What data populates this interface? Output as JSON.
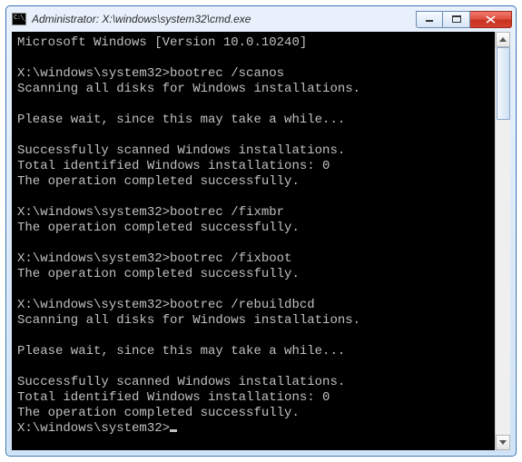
{
  "window": {
    "title": "Administrator: X:\\windows\\system32\\cmd.exe"
  },
  "terminal": {
    "banner": "Microsoft Windows [Version 10.0.10240]",
    "blocks": [
      {
        "prompt": "X:\\windows\\system32>",
        "command": "bootrec /scanos",
        "output": [
          "Scanning all disks for Windows installations.",
          "",
          "Please wait, since this may take a while...",
          "",
          "Successfully scanned Windows installations.",
          "Total identified Windows installations: 0",
          "The operation completed successfully."
        ]
      },
      {
        "prompt": "X:\\windows\\system32>",
        "command": "bootrec /fixmbr",
        "output": [
          "The operation completed successfully."
        ]
      },
      {
        "prompt": "X:\\windows\\system32>",
        "command": "bootrec /fixboot",
        "output": [
          "The operation completed successfully."
        ]
      },
      {
        "prompt": "X:\\windows\\system32>",
        "command": "bootrec /rebuildbcd",
        "output": [
          "Scanning all disks for Windows installations.",
          "",
          "Please wait, since this may take a while...",
          "",
          "Successfully scanned Windows installations.",
          "Total identified Windows installations: 0",
          "The operation completed successfully."
        ]
      }
    ],
    "current_prompt": "X:\\windows\\system32>"
  }
}
